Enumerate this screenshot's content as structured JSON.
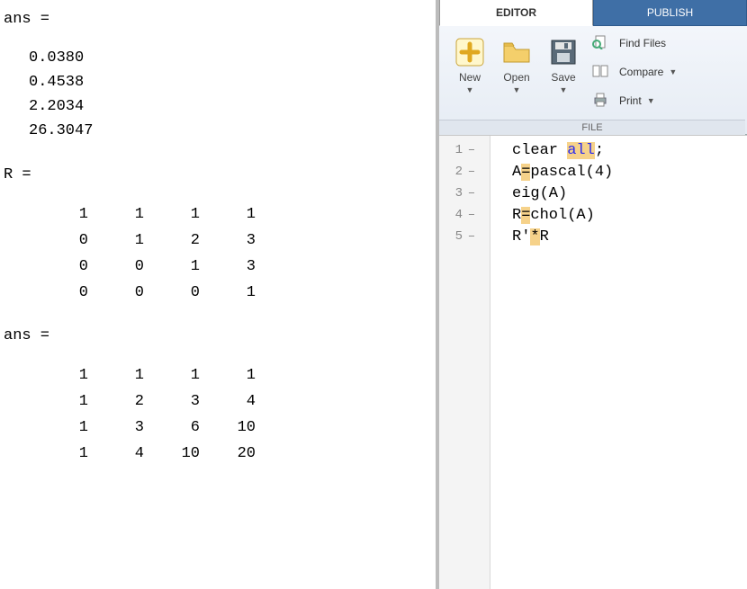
{
  "command_window": {
    "var1_label": "ans =",
    "var1_values": [
      "0.0380",
      "0.4538",
      "2.2034",
      "26.3047"
    ],
    "var2_label": "R =",
    "var2_matrix": [
      [
        "1",
        "1",
        "1",
        "1"
      ],
      [
        "0",
        "1",
        "2",
        "3"
      ],
      [
        "0",
        "0",
        "1",
        "3"
      ],
      [
        "0",
        "0",
        "0",
        "1"
      ]
    ],
    "var3_label": "ans =",
    "var3_matrix": [
      [
        "1",
        "1",
        "1",
        "1"
      ],
      [
        "1",
        "2",
        "3",
        "4"
      ],
      [
        "1",
        "3",
        "6",
        "10"
      ],
      [
        "1",
        "4",
        "10",
        "20"
      ]
    ]
  },
  "editor": {
    "tabs": {
      "editor": "EDITOR",
      "publish": "PUBLISH"
    },
    "buttons": {
      "new": "New",
      "open": "Open",
      "save": "Save",
      "find_files": "Find Files",
      "compare": "Compare",
      "print": "Print"
    },
    "group_label": "FILE",
    "code_lines": [
      {
        "n": "1",
        "dash": "–",
        "segs": [
          {
            "t": "clear "
          },
          {
            "t": "all",
            "cls": "fn hl"
          },
          {
            "t": ";"
          }
        ]
      },
      {
        "n": "2",
        "dash": "–",
        "segs": [
          {
            "t": "A"
          },
          {
            "t": "=",
            "cls": "hl"
          },
          {
            "t": "pascal(4)"
          }
        ]
      },
      {
        "n": "3",
        "dash": "–",
        "segs": [
          {
            "t": "eig(A)"
          }
        ]
      },
      {
        "n": "4",
        "dash": "–",
        "segs": [
          {
            "t": "R"
          },
          {
            "t": "=",
            "cls": "hl"
          },
          {
            "t": "chol(A)"
          }
        ]
      },
      {
        "n": "5",
        "dash": "–",
        "segs": [
          {
            "t": "R'"
          },
          {
            "t": "*",
            "cls": "hl"
          },
          {
            "t": "R"
          }
        ]
      }
    ]
  },
  "chart_data": {
    "type": "table",
    "title": "MATLAB command window output and editor script",
    "ans_eig": [
      0.038,
      0.4538,
      2.2034,
      26.3047
    ],
    "R_chol": [
      [
        1,
        1,
        1,
        1
      ],
      [
        0,
        1,
        2,
        3
      ],
      [
        0,
        0,
        1,
        3
      ],
      [
        0,
        0,
        0,
        1
      ]
    ],
    "ans_RtR": [
      [
        1,
        1,
        1,
        1
      ],
      [
        1,
        2,
        3,
        4
      ],
      [
        1,
        3,
        6,
        10
      ],
      [
        1,
        4,
        10,
        20
      ]
    ],
    "script": [
      "clear all;",
      "A=pascal(4)",
      "eig(A)",
      "R=chol(A)",
      "R'*R"
    ]
  }
}
